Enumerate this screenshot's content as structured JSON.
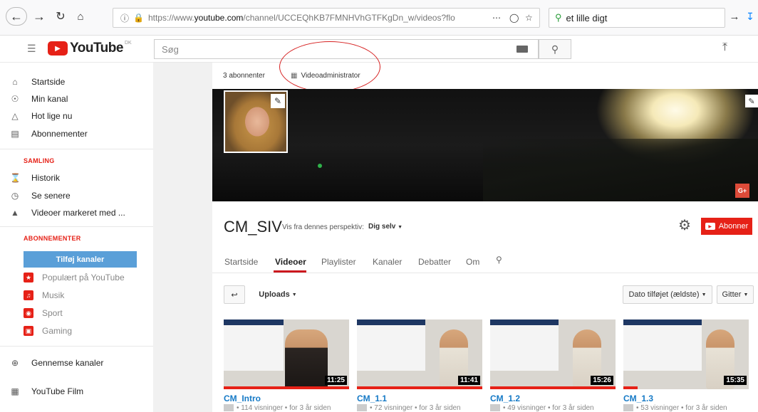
{
  "browser": {
    "url_prefix": "https://www.",
    "url_domain": "youtube.com",
    "url_rest": "/channel/UCCEQhKB7FMNHVhGTFKgDn_w/videos?flo",
    "search_query": "et lille digt"
  },
  "header": {
    "logo_text": "YouTube",
    "logo_country": "DK",
    "search_placeholder": "Søg"
  },
  "sidebar": {
    "nav": [
      {
        "label": "Startside",
        "icon": "home-icon"
      },
      {
        "label": "Min kanal",
        "icon": "account-icon"
      },
      {
        "label": "Hot lige nu",
        "icon": "flame-icon"
      },
      {
        "label": "Abonnementer",
        "icon": "subscriptions-icon"
      }
    ],
    "library_heading": "SAMLING",
    "library": [
      {
        "label": "Historik",
        "icon": "hourglass-icon"
      },
      {
        "label": "Se senere",
        "icon": "clock-icon"
      },
      {
        "label": "Videoer markeret med ...",
        "icon": "thumbs-up-icon"
      }
    ],
    "subscriptions_heading": "ABONNEMENTER",
    "add_channels_label": "Tilføj kanaler",
    "channels": [
      {
        "label": "Populært på YouTube",
        "icon": "star-icon"
      },
      {
        "label": "Musik",
        "icon": "music-icon"
      },
      {
        "label": "Sport",
        "icon": "sport-icon"
      },
      {
        "label": "Gaming",
        "icon": "gaming-icon"
      }
    ],
    "browse_channels": "Gennemse kanaler",
    "youtube_film": "YouTube Film"
  },
  "channel": {
    "subscribers": "3 abonnenter",
    "video_manager": "Videoadministrator",
    "name": "CM_SIV",
    "perspective_label": "Vis fra dennes perspektiv:",
    "perspective_value": "Dig selv",
    "subscribe_label": "Abonner",
    "tabs": [
      "Startside",
      "Videoer",
      "Playlister",
      "Kanaler",
      "Debatter",
      "Om"
    ],
    "active_tab": "Videoer",
    "uploads_label": "Uploads",
    "sort_label": "Dato tilføjet (ældste)",
    "grid_label": "Gitter"
  },
  "videos": [
    {
      "title": "CM_Intro",
      "duration": "11:25",
      "meta": "• 114 visninger • for 3 år siden"
    },
    {
      "title": "CM_1.1",
      "duration": "11:41",
      "meta": "• 72 visninger • for 3 år siden"
    },
    {
      "title": "CM_1.2",
      "duration": "15:26",
      "meta": "• 49 visninger • for 3 år siden"
    },
    {
      "title": "CM_1.3",
      "duration": "15:35",
      "meta": "• 53 visninger • for 3 år siden"
    }
  ],
  "colors": {
    "brand_red": "#e62117",
    "link_blue": "#167ac6",
    "add_channels_bg": "#5a9fd8"
  }
}
